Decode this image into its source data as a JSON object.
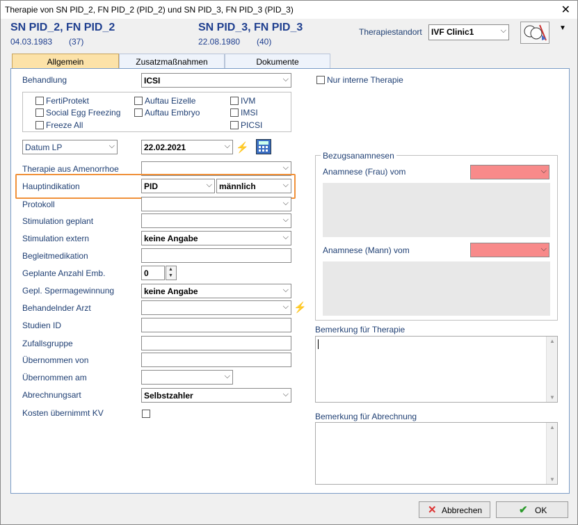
{
  "window": {
    "title": "Therapie von SN PID_2, FN PID_2 (PID_2) und SN PID_3, FN PID_3 (PID_3)"
  },
  "patient1": {
    "name": "SN PID_2, FN PID_2",
    "dob": "04.03.1983",
    "age": "(37)"
  },
  "patient2": {
    "name": "SN PID_3, FN PID_3",
    "dob": "22.08.1980",
    "age": "(40)"
  },
  "standort": {
    "label": "Therapiestandort",
    "value": "IVF Clinic1"
  },
  "tabs": [
    "Allgemein",
    "Zusatzmaßnahmen",
    "Dokumente"
  ],
  "behandlung": {
    "label": "Behandlung",
    "value": "ICSI"
  },
  "checkboxes": {
    "col1": [
      "FertiProtekt",
      "Social Egg Freezing",
      "Freeze All"
    ],
    "col2": [
      "Auftau Eizelle",
      "Auftau Embryo"
    ],
    "col3": [
      "IVM",
      "IMSI",
      "PICSI"
    ]
  },
  "nur_interne": "Nur interne Therapie",
  "datum": {
    "type": "Datum LP",
    "value": "22.02.2021"
  },
  "fields": {
    "amenorrhoe": "Therapie aus Amenorrhoe",
    "hauptindikation": "Hauptindikation",
    "hauptindikation_value": "PID",
    "hauptindikation_gender": "männlich",
    "protokoll": "Protokoll",
    "stim_geplant": "Stimulation geplant",
    "stim_extern": "Stimulation extern",
    "stim_extern_value": "keine Angabe",
    "begleitmed": "Begleitmedikation",
    "anzahl_emb": "Geplante Anzahl Emb.",
    "anzahl_emb_value": "0",
    "sperma": "Gepl. Spermagewinnung",
    "sperma_value": "keine Angabe",
    "arzt": "Behandelnder Arzt",
    "studien": "Studien ID",
    "zufall": "Zufallsgruppe",
    "uebernommen_von": "Übernommen von",
    "uebernommen_am": "Übernommen am",
    "abrechnungsart": "Abrechnungsart",
    "abrechnungsart_value": "Selbstzahler",
    "kosten": "Kosten übernimmt KV"
  },
  "bezug": {
    "title": "Bezugsanamnesen",
    "frau": "Anamnese (Frau) vom",
    "mann": "Anamnese (Mann) vom"
  },
  "bemerkung_therapie": "Bemerkung für Therapie",
  "bemerkung_abrechnung": "Bemerkung für Abrechnung",
  "buttons": {
    "cancel": "Abbrechen",
    "ok": "OK"
  },
  "colors": {
    "accent_orange": "#f0913a",
    "required_red": "#f88a8a",
    "tab_active": "#fce2a8"
  }
}
